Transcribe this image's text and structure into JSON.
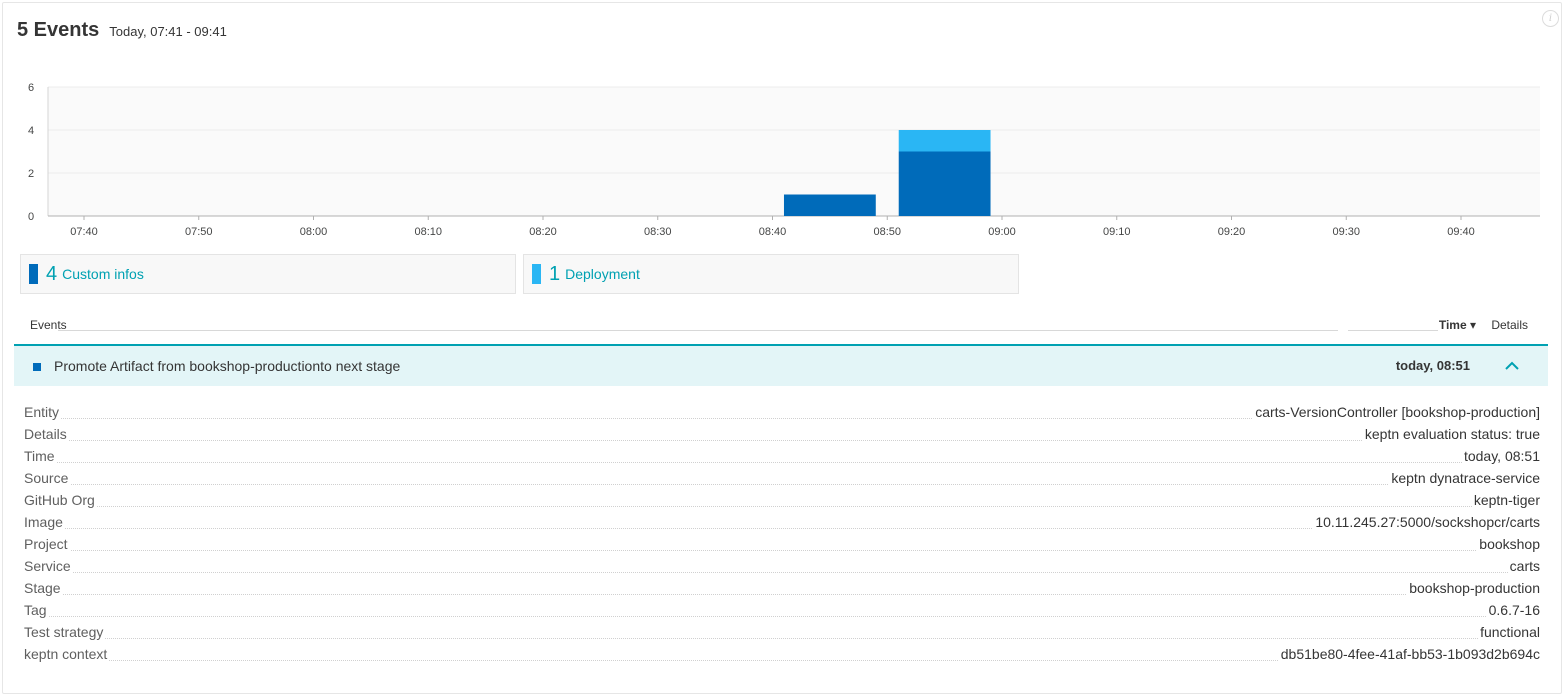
{
  "header": {
    "count_label": "5 Events",
    "time_range": "Today, 07:41 - 09:41"
  },
  "colors": {
    "custom_info": "#006bba",
    "deployment": "#2ab6f4",
    "accent": "#00a1b2"
  },
  "chart_data": {
    "type": "bar",
    "stacked": true,
    "y_ticks": [
      "6",
      "4",
      "2",
      "0"
    ],
    "ylim": [
      0,
      6
    ],
    "x_ticks": [
      "07:40",
      "07:50",
      "08:00",
      "08:10",
      "08:20",
      "08:30",
      "08:40",
      "08:50",
      "09:00",
      "09:10",
      "09:20",
      "09:30",
      "09:40"
    ],
    "bins": [
      {
        "start": "08:41",
        "end": "08:49",
        "custom_infos": 1,
        "deployment": 0
      },
      {
        "start": "08:51",
        "end": "08:59",
        "custom_infos": 3,
        "deployment": 1
      }
    ]
  },
  "legend": [
    {
      "count": "4",
      "label": "Custom infos"
    },
    {
      "count": "1",
      "label": "Deployment"
    }
  ],
  "table": {
    "col_events": "Events",
    "col_time": "Time ▾",
    "col_details": "Details"
  },
  "event": {
    "title": "Promote Artifact from bookshop-productionto next stage",
    "time": "today, 08:51",
    "chevron_icon": "chevron-up-icon"
  },
  "details": [
    {
      "key": "Entity",
      "value": "carts-VersionController [bookshop-production]"
    },
    {
      "key": "Details",
      "value": "keptn evaluation status: true"
    },
    {
      "key": "Time",
      "value": "today, 08:51"
    },
    {
      "key": "Source",
      "value": "keptn dynatrace-service"
    },
    {
      "key": "GitHub Org",
      "value": "keptn-tiger"
    },
    {
      "key": "Image",
      "value": "10.11.245.27:5000/sockshopcr/carts"
    },
    {
      "key": "Project",
      "value": "bookshop"
    },
    {
      "key": "Service",
      "value": "carts"
    },
    {
      "key": "Stage",
      "value": "bookshop-production"
    },
    {
      "key": "Tag",
      "value": "0.6.7-16"
    },
    {
      "key": "Test strategy",
      "value": "functional"
    },
    {
      "key": "keptn context",
      "value": "db51be80-4fee-41af-bb53-1b093d2b694c"
    }
  ]
}
